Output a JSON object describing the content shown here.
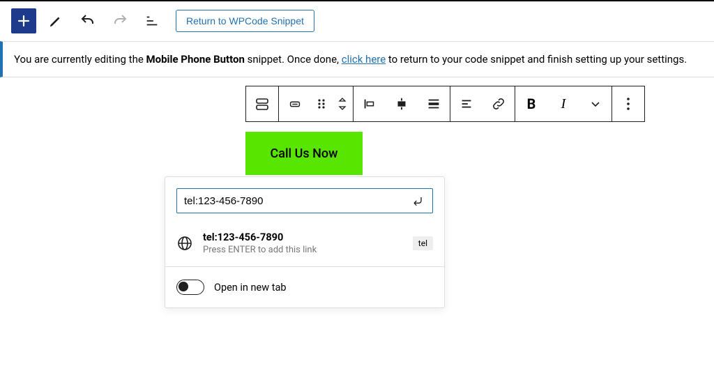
{
  "header": {
    "return_label": "Return to WPCode Snippet"
  },
  "notice": {
    "prefix": "You are currently editing the ",
    "snippet_name": "Mobile Phone Button",
    "mid": " snippet. Once done, ",
    "link_text": "click here",
    "suffix": " to return to your code snippet and finish setting up your settings."
  },
  "block_toolbar": {
    "group1": {
      "block_type": "button-block-icon"
    },
    "icons": {
      "mover": "mover-icon",
      "drag": "drag-handle-icon",
      "updown": "arrows-updown-icon",
      "align_left": "align-left-icon",
      "align_center": "align-center-icon",
      "align_full": "align-full-icon",
      "justify": "justify-icon",
      "link": "link-icon",
      "bold": "B",
      "italic": "I",
      "chevron": "chevron-down-icon",
      "more": "more-options-icon"
    }
  },
  "button_block": {
    "label": "Call Us Now"
  },
  "link_popover": {
    "input_value": "tel:123-456-7890",
    "suggestion_title": "tel:123-456-7890",
    "suggestion_sub": "Press ENTER to add this link",
    "tag": "tel",
    "new_tab_label": "Open in new tab",
    "new_tab_on": false
  }
}
